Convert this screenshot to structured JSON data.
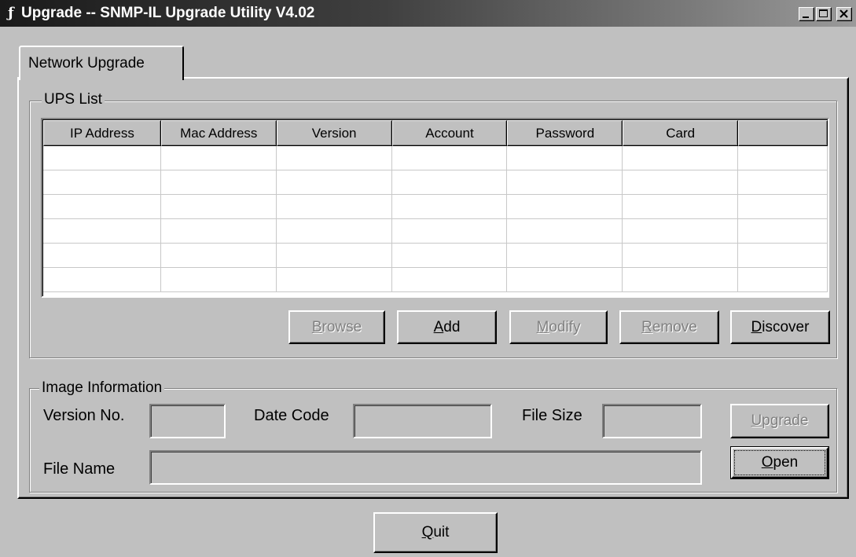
{
  "window": {
    "title": "Upgrade --  SNMP-IL Upgrade Utility V4.02",
    "icon": "app-icon",
    "caption_buttons": [
      "minimize-icon",
      "maximize-icon",
      "close-icon"
    ]
  },
  "tabs": [
    {
      "label": "Network Upgrade",
      "active": true
    }
  ],
  "ups_list": {
    "group_label": "UPS List",
    "columns": [
      "IP Address",
      "Mac Address",
      "Version",
      "Account",
      "Password",
      "Card",
      ""
    ],
    "rows": [
      [
        "",
        "",
        "",
        "",
        "",
        "",
        ""
      ],
      [
        "",
        "",
        "",
        "",
        "",
        "",
        ""
      ],
      [
        "",
        "",
        "",
        "",
        "",
        "",
        ""
      ],
      [
        "",
        "",
        "",
        "",
        "",
        "",
        ""
      ],
      [
        "",
        "",
        "",
        "",
        "",
        "",
        ""
      ],
      [
        "",
        "",
        "",
        "",
        "",
        "",
        ""
      ]
    ],
    "buttons": {
      "browse": {
        "pre": "",
        "mnemonic": "B",
        "post": "rowse",
        "enabled": false
      },
      "add": {
        "pre": "",
        "mnemonic": "A",
        "post": "dd",
        "enabled": true
      },
      "modify": {
        "pre": "",
        "mnemonic": "M",
        "post": "odify",
        "enabled": false
      },
      "remove": {
        "pre": "",
        "mnemonic": "R",
        "post": "emove",
        "enabled": false
      },
      "discover": {
        "pre": "",
        "mnemonic": "D",
        "post": "iscover",
        "enabled": true
      }
    }
  },
  "image_info": {
    "group_label": "Image Information",
    "version_label": "Version No.",
    "version_value": "",
    "date_label": "Date Code",
    "date_value": "",
    "size_label": "File Size",
    "size_value": "",
    "filename_label": "File Name",
    "filename_value": "",
    "upgrade_button": {
      "pre": "",
      "mnemonic": "U",
      "post": "pgrade",
      "enabled": false
    },
    "open_button": {
      "pre": "",
      "mnemonic": "O",
      "post": "pen",
      "enabled": true,
      "default": true
    }
  },
  "footer": {
    "quit_button": {
      "pre": "",
      "mnemonic": "Q",
      "post": "uit",
      "enabled": true
    }
  }
}
